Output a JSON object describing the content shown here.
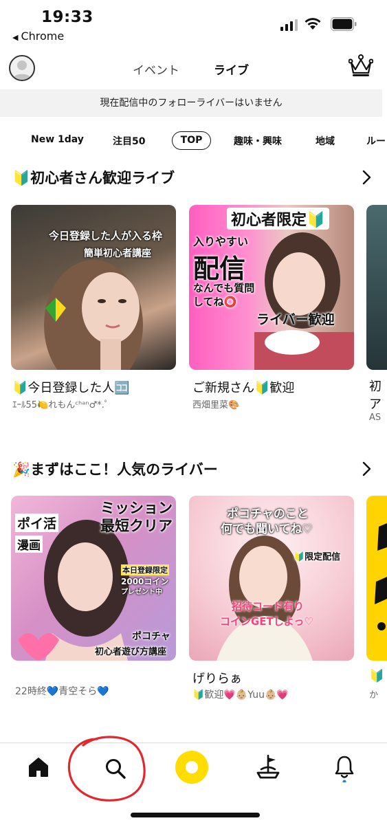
{
  "status_bar": {
    "time": "19:33",
    "back_app": "Chrome"
  },
  "header": {
    "tabs": [
      "イベント",
      "ライブ"
    ],
    "active_tab": "ライブ"
  },
  "notice": "現在配信中のフォローライバーはいません",
  "categories": [
    "New 1day",
    "注目50",
    "TOP",
    "趣味・興味",
    "地域",
    "ルー"
  ],
  "active_category": "TOP",
  "sections": [
    {
      "title": "🔰初心者さん歓迎ライブ",
      "cards": [
        {
          "title": "🔰今日登録した人🈁",
          "subtitle": "ｴｰﾙ55🍋れもんᶜʰᵃⁿ♂*.ﾟ",
          "overlay": [
            "今日登録した人が入る枠",
            "簡単初心者講座"
          ]
        },
        {
          "title": "ご新規さん🔰歓迎",
          "subtitle": "西畑里菜🎨",
          "overlay": [
            "初心者限定🔰",
            "入りやすい",
            "配信",
            "なんでも質問",
            "してね⭕",
            "ライバー歓迎"
          ]
        },
        {
          "title": "初",
          "subtitle2": "ア",
          "subtitle": "AS"
        }
      ]
    },
    {
      "title": "🎉まずはここ！人気のライバー",
      "cards": [
        {
          "title": "",
          "subtitle": "22時終💙青空そら💙",
          "overlay": [
            "ミッション",
            "最短クリア",
            "ポイ活",
            "漫画",
            "本日登録限定",
            "2000コイン",
            "プレゼント中",
            "ポコチャ",
            "初心者遊び方講座"
          ]
        },
        {
          "title": "げりらぁ",
          "subtitle": "🔰歓迎💗👶🏼Yuu👶🏼💗",
          "overlay": [
            "ポコチャのこと",
            "何でも聞いてね♡",
            "🔰限定配信",
            "招待コード有り",
            "コインGETしよっ♡"
          ]
        },
        {
          "title": "🔰",
          "subtitle": "か"
        }
      ]
    }
  ],
  "bottom_nav": [
    "home",
    "search",
    "live",
    "ship",
    "notifications"
  ],
  "colors": {
    "accent_yellow": "#ffdd00",
    "notice_bg": "#f2f2f2",
    "badge_blue": "#1e88e5",
    "annotation_red": "#e0282e"
  }
}
